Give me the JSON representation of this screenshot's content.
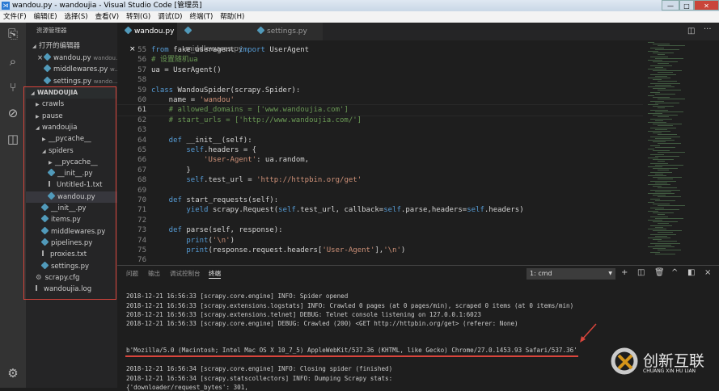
{
  "window": {
    "title": "wandou.py - wandoujia - Visual Studio Code [管理员]",
    "controls": [
      "—",
      "□",
      "✕"
    ]
  },
  "menu": [
    "文件(F)",
    "编辑(E)",
    "选择(S)",
    "查看(V)",
    "转到(G)",
    "调试(D)",
    "终端(T)",
    "帮助(H)"
  ],
  "sidebar": {
    "title": "资源管理器",
    "open_editors_header": "打开的编辑器",
    "open_editors": [
      {
        "name": "wandou.py",
        "dir": "wandou..."
      },
      {
        "name": "middlewares.py",
        "dir": "w..."
      },
      {
        "name": "settings.py",
        "dir": "wando..."
      }
    ],
    "project": "WANDOUJIA",
    "tree": [
      {
        "name": "crawls",
        "type": "folder",
        "level": 1,
        "open": false
      },
      {
        "name": "pause",
        "type": "folder",
        "level": 1,
        "open": false
      },
      {
        "name": "wandoujia",
        "type": "folder",
        "level": 1,
        "open": true
      },
      {
        "name": "__pycache__",
        "type": "folder",
        "level": 2,
        "open": false
      },
      {
        "name": "spiders",
        "type": "folder",
        "level": 2,
        "open": true
      },
      {
        "name": "__pycache__",
        "type": "folder",
        "level": 3,
        "open": false
      },
      {
        "name": "__init__.py",
        "type": "py",
        "level": 3
      },
      {
        "name": "Untitled-1.txt",
        "type": "txt",
        "level": 3
      },
      {
        "name": "wandou.py",
        "type": "py",
        "level": 3,
        "selected": true
      },
      {
        "name": "__init__.py",
        "type": "py",
        "level": 2
      },
      {
        "name": "items.py",
        "type": "py",
        "level": 2
      },
      {
        "name": "middlewares.py",
        "type": "py",
        "level": 2
      },
      {
        "name": "pipelines.py",
        "type": "py",
        "level": 2
      },
      {
        "name": "proxies.txt",
        "type": "txt",
        "level": 2
      },
      {
        "name": "settings.py",
        "type": "py",
        "level": 2
      },
      {
        "name": "scrapy.cfg",
        "type": "cfg",
        "level": 1
      },
      {
        "name": "wandoujia.log",
        "type": "txt",
        "level": 1
      }
    ]
  },
  "tabs": [
    {
      "label": "wandou.py",
      "active": true,
      "close": "×"
    },
    {
      "label": "middlewares.py"
    },
    {
      "label": "settings.py"
    }
  ],
  "editor": {
    "current_line": 61,
    "lines": [
      {
        "n": 55,
        "t": [
          [
            "from ",
            "kw"
          ],
          [
            "fake_useragent ",
            ""
          ],
          [
            "import ",
            "kw"
          ],
          [
            "UserAgent",
            ""
          ]
        ]
      },
      {
        "n": 56,
        "t": [
          [
            "# 设置随机ua",
            "cm"
          ]
        ]
      },
      {
        "n": 57,
        "t": [
          [
            "ua = UserAgent()",
            ""
          ]
        ]
      },
      {
        "n": 58,
        "t": []
      },
      {
        "n": 59,
        "t": [
          [
            "class ",
            "kw"
          ],
          [
            "WandouSpider(scrapy.Spider):",
            ""
          ]
        ]
      },
      {
        "n": 60,
        "t": [
          [
            "    name = ",
            ""
          ],
          [
            "'wandou'",
            "st"
          ]
        ]
      },
      {
        "n": 61,
        "t": [
          [
            "    # allowed_domains = ['www.wandoujia.com']",
            "cm"
          ]
        ]
      },
      {
        "n": 62,
        "t": [
          [
            "    # start_urls = ['http://www.wandoujia.com/']",
            "cm"
          ]
        ]
      },
      {
        "n": 63,
        "t": []
      },
      {
        "n": 64,
        "t": [
          [
            "    def ",
            "kw"
          ],
          [
            "__init__(self):",
            ""
          ]
        ]
      },
      {
        "n": 65,
        "t": [
          [
            "        ",
            ""
          ],
          [
            "self",
            "sf"
          ],
          [
            ".headers = {",
            ""
          ]
        ]
      },
      {
        "n": 66,
        "t": [
          [
            "            ",
            ""
          ],
          [
            "'User-Agent'",
            "st"
          ],
          [
            ": ua.random,",
            ""
          ]
        ]
      },
      {
        "n": 67,
        "t": [
          [
            "        }",
            ""
          ]
        ]
      },
      {
        "n": 68,
        "t": [
          [
            "        ",
            ""
          ],
          [
            "self",
            "sf"
          ],
          [
            ".test_url = ",
            ""
          ],
          [
            "'http://httpbin.org/get'",
            "st"
          ]
        ]
      },
      {
        "n": 69,
        "t": []
      },
      {
        "n": 70,
        "t": [
          [
            "    def ",
            "kw"
          ],
          [
            "start_requests(self):",
            ""
          ]
        ]
      },
      {
        "n": 71,
        "t": [
          [
            "        ",
            ""
          ],
          [
            "yield ",
            "kw"
          ],
          [
            "scrapy.Request(",
            ""
          ],
          [
            "self",
            "sf"
          ],
          [
            ".test_url, callback=",
            ""
          ],
          [
            "self",
            "sf"
          ],
          [
            ".parse,headers=",
            ""
          ],
          [
            "self",
            "sf"
          ],
          [
            ".headers)",
            ""
          ]
        ]
      },
      {
        "n": 72,
        "t": []
      },
      {
        "n": 73,
        "t": [
          [
            "    def ",
            "kw"
          ],
          [
            "parse(self, response):",
            ""
          ]
        ]
      },
      {
        "n": 74,
        "t": [
          [
            "        ",
            ""
          ],
          [
            "print",
            "sf"
          ],
          [
            "(",
            ""
          ],
          [
            "'\\n'",
            "st"
          ],
          [
            ")",
            ""
          ]
        ]
      },
      {
        "n": 75,
        "t": [
          [
            "        ",
            ""
          ],
          [
            "print",
            "sf"
          ],
          [
            "(response.request.headers[",
            ""
          ],
          [
            "'User-Agent'",
            "st"
          ],
          [
            "],",
            ""
          ],
          [
            "'\\n'",
            "st"
          ],
          [
            ")",
            ""
          ]
        ]
      },
      {
        "n": 76,
        "t": []
      }
    ]
  },
  "panel": {
    "tabs": [
      "问题",
      "输出",
      "调试控制台",
      "终端"
    ],
    "active_tab": "终端",
    "terminal_select": "1: cmd",
    "icons": [
      "plus-icon",
      "split-icon",
      "trash-icon",
      "chevron-up-icon",
      "maximize-icon",
      "close-icon"
    ],
    "lines": [
      "2018-12-21 16:56:33 [scrapy.core.engine] INFO: Spider opened",
      "2018-12-21 16:56:33 [scrapy.extensions.logstats] INFO: Crawled 0 pages (at 0 pages/min), scraped 0 items (at 0 items/min)",
      "2018-12-21 16:56:33 [scrapy.extensions.telnet] DEBUG: Telnet console listening on 127.0.0.1:6023",
      "2018-12-21 16:56:33 [scrapy.core.engine] DEBUG: Crawled (200) <GET http://httpbin.org/get> (referer: None)",
      "b'Mozilla/5.0 (Macintosh; Intel Mac OS X 10_7_5) AppleWebKit/537.36 (KHTML, like Gecko) Chrome/27.0.1453.93 Safari/537.36'",
      "2018-12-21 16:56:34 [scrapy.core.engine] INFO: Closing spider (finished)",
      "2018-12-21 16:56:34 [scrapy.statscollectors] INFO: Dumping Scrapy stats:",
      "{'downloader/request_bytes': 301,"
    ]
  },
  "watermark": {
    "name": "创新互联",
    "sub": "CHUANG XIN HU LIAN"
  },
  "colors": {
    "annotation": "#d9453c",
    "keyword": "#569cd6",
    "string": "#ce9178",
    "comment": "#6a9955"
  }
}
